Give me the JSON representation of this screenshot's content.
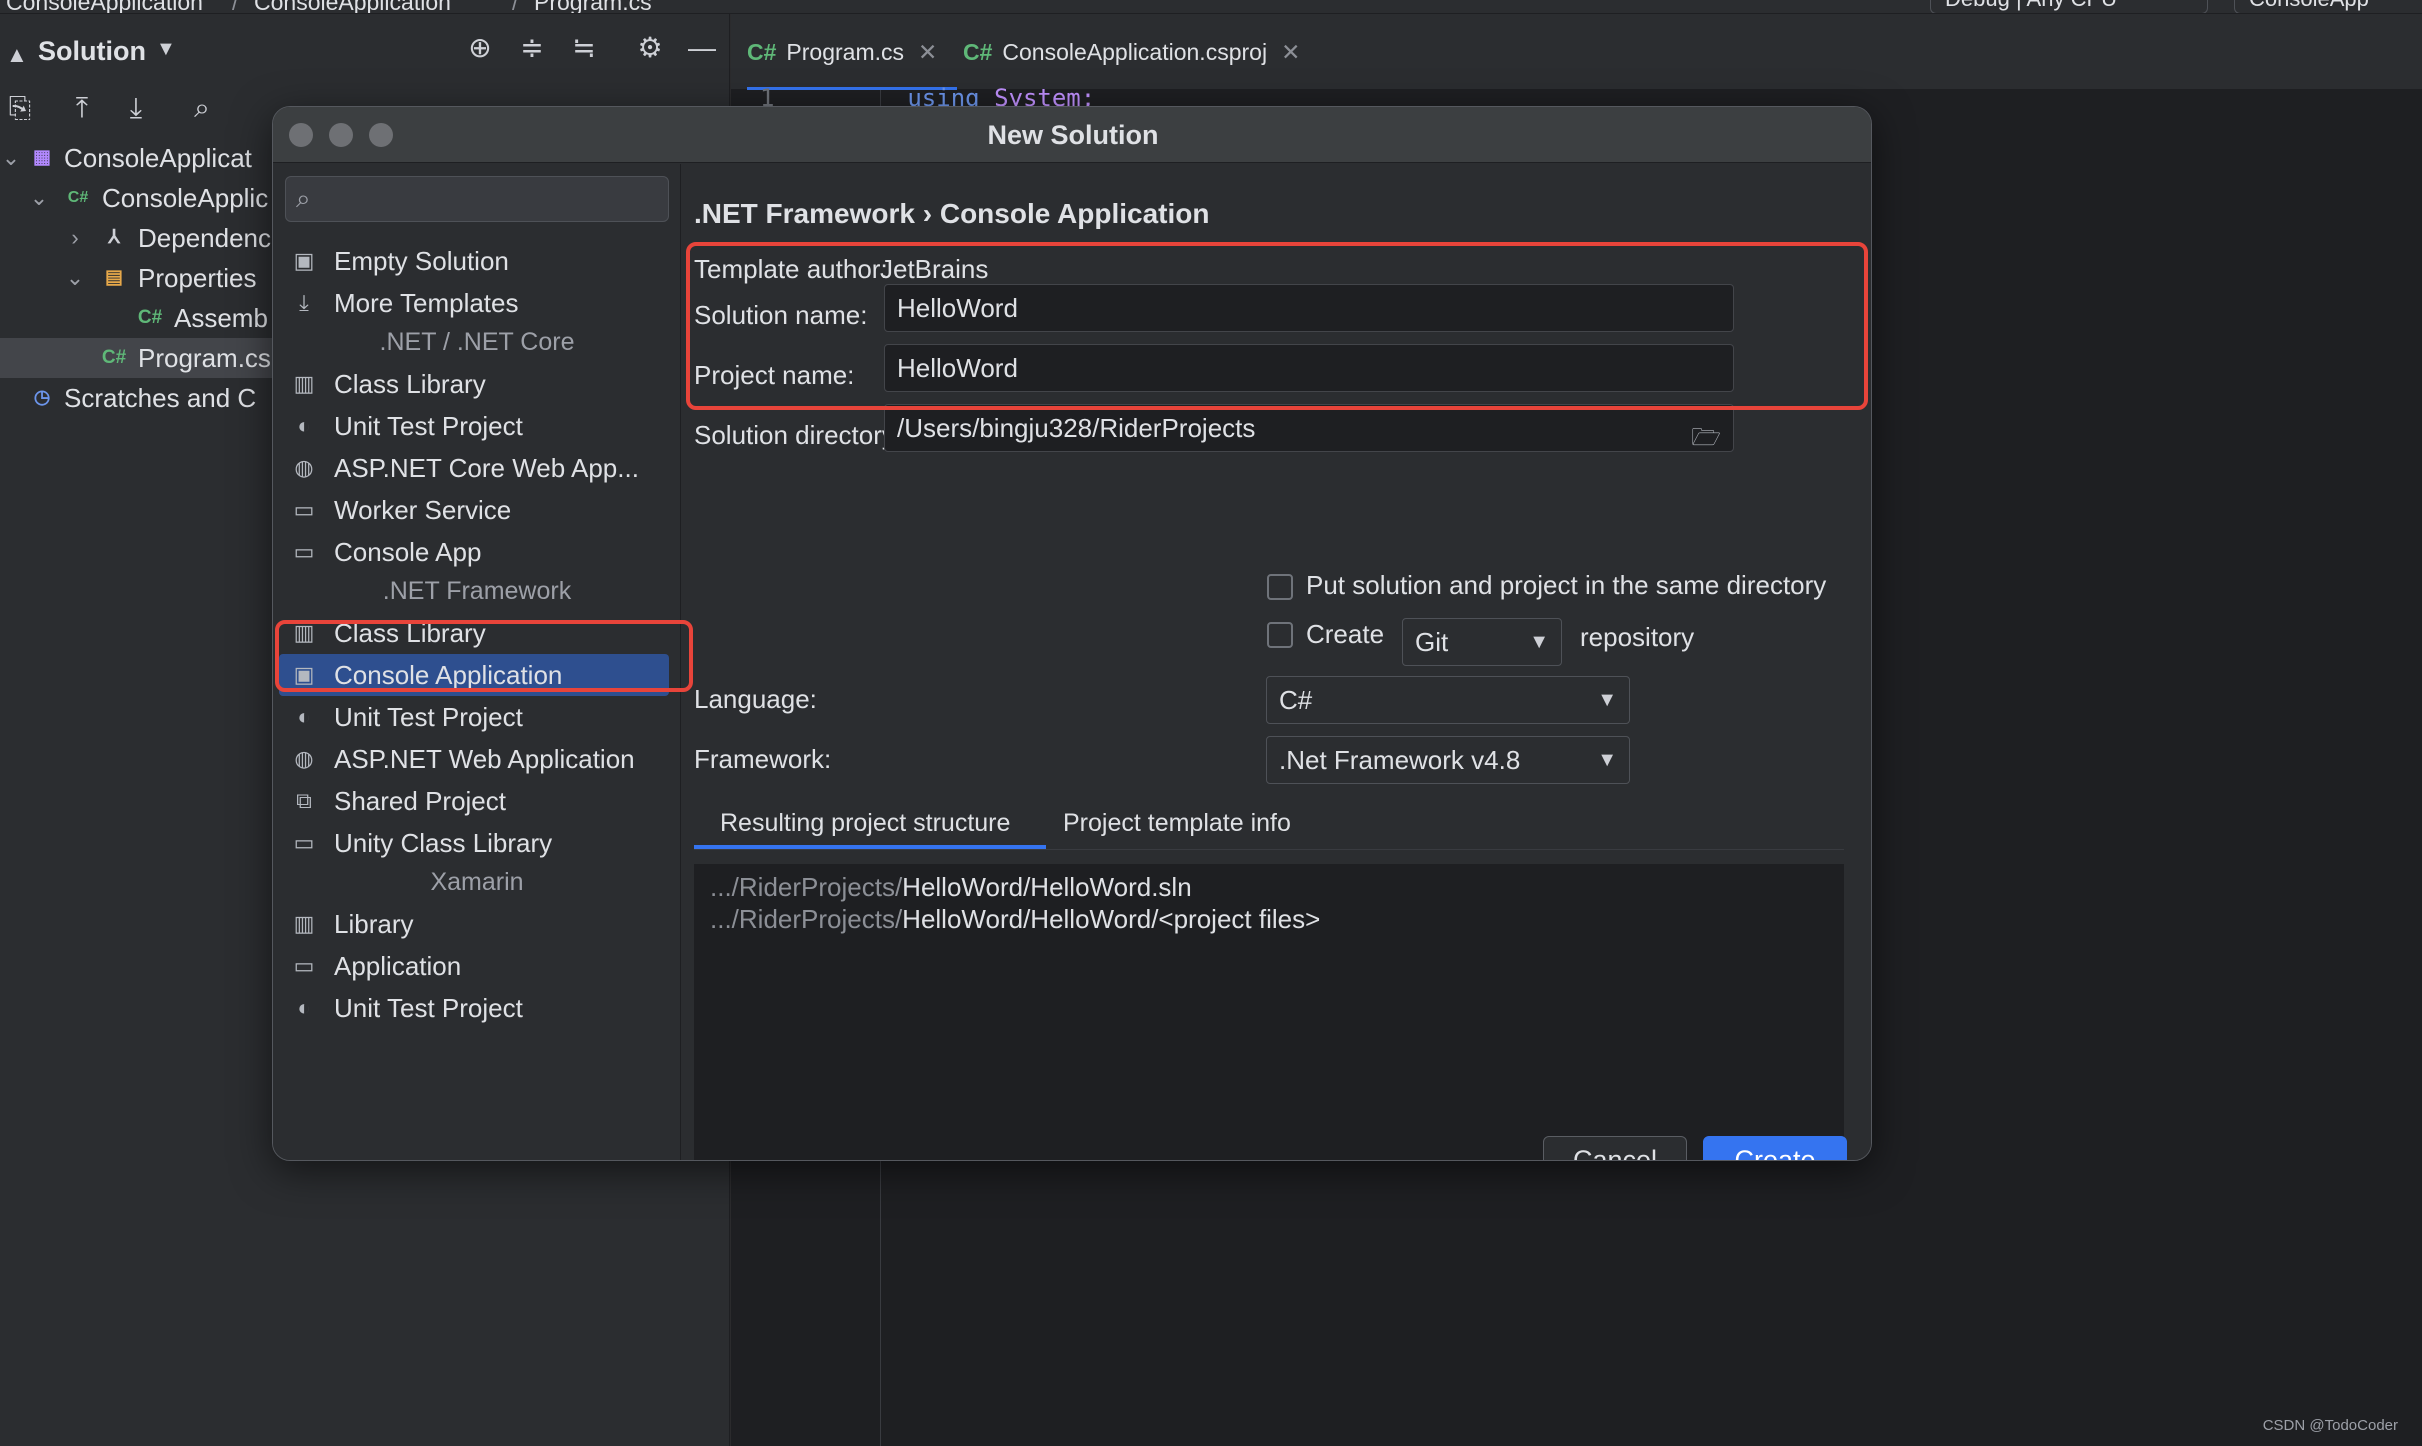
{
  "breadcrumb": {
    "project": "ConsoleApplication",
    "module": "ConsoleApplication",
    "file": "Program.cs",
    "run_config": "Debug | Any CPU",
    "run_target": "ConsoleApp"
  },
  "project_panel": {
    "title": "Solution",
    "tree": [
      {
        "label": "ConsoleApplicat",
        "icon": "solution-icon"
      },
      {
        "label": "ConsoleApplic",
        "icon": "csharp-project-icon"
      },
      {
        "label": "Dependenc",
        "icon": "dependencies-icon"
      },
      {
        "label": "Properties",
        "icon": "folder-icon"
      },
      {
        "label": "Assemb",
        "icon": "csharp-file-icon",
        "badge": "C#"
      },
      {
        "label": "Program.cs",
        "icon": "csharp-file-icon",
        "badge": "C#",
        "selected": true
      },
      {
        "label": "Scratches and C",
        "icon": "scratches-icon"
      }
    ]
  },
  "editor": {
    "tabs": [
      {
        "label": "Program.cs",
        "badge": "C#",
        "active": true
      },
      {
        "label": "ConsoleApplication.csproj",
        "badge": "C#",
        "active": false
      }
    ],
    "line_no": "1",
    "code_keyword": "using",
    "code_namespace": "System;"
  },
  "dialog": {
    "title": "New Solution",
    "search_placeholder": "",
    "templates": [
      {
        "type": "item",
        "label": "Empty Solution",
        "icon": "empty-solution-icon"
      },
      {
        "type": "item",
        "label": "More Templates",
        "icon": "download-icon"
      },
      {
        "type": "group",
        "label": ".NET / .NET Core"
      },
      {
        "type": "item",
        "label": "Class Library",
        "icon": "library-icon"
      },
      {
        "type": "item",
        "label": "Unit Test Project",
        "icon": "test-icon"
      },
      {
        "type": "item",
        "label": "ASP.NET Core Web App...",
        "icon": "globe-icon"
      },
      {
        "type": "item",
        "label": "Worker Service",
        "icon": "window-icon"
      },
      {
        "type": "item",
        "label": "Console App",
        "icon": "window-icon"
      },
      {
        "type": "group",
        "label": ".NET Framework"
      },
      {
        "type": "item",
        "label": "Class Library",
        "icon": "library-icon"
      },
      {
        "type": "item",
        "label": "Console Application",
        "icon": "console-icon",
        "selected": true
      },
      {
        "type": "item",
        "label": "Unit Test Project",
        "icon": "test-icon"
      },
      {
        "type": "item",
        "label": "ASP.NET Web Application",
        "icon": "globe-icon"
      },
      {
        "type": "item",
        "label": "Shared Project",
        "icon": "shared-icon"
      },
      {
        "type": "item",
        "label": "Unity Class Library",
        "icon": "window-icon"
      },
      {
        "type": "group",
        "label": "Xamarin"
      },
      {
        "type": "item",
        "label": "Library",
        "icon": "library-icon"
      },
      {
        "type": "item",
        "label": "Application",
        "icon": "window-icon"
      },
      {
        "type": "item",
        "label": "Unit Test Project",
        "icon": "test-icon"
      }
    ],
    "breadcrumb": {
      "parent": ".NET Framework",
      "separator": "›",
      "current": "Console Application"
    },
    "form": {
      "template_author_label": "Template author:",
      "template_author": "JetBrains",
      "solution_name_label": "Solution name:",
      "solution_name": "HelloWord",
      "project_name_label": "Project name:",
      "project_name": "HelloWord",
      "solution_dir_label": "Solution directory:",
      "solution_dir": "/Users/bingju328/RiderProjects",
      "same_dir_label": "Put solution and project in the same directory",
      "same_dir_checked": false,
      "create_label": "Create",
      "create_checked": false,
      "vcs": "Git",
      "repository_label": "repository",
      "language_label": "Language:",
      "language": "C#",
      "framework_label": "Framework:",
      "framework": ".Net Framework v4.8"
    },
    "info_tabs": [
      {
        "label": "Resulting project structure",
        "active": true
      },
      {
        "label": "Project template info",
        "active": false
      }
    ],
    "structure": [
      {
        "prefix": ".../RiderProjects/",
        "path": "HelloWord/HelloWord.sln"
      },
      {
        "prefix": ".../RiderProjects/",
        "path": "HelloWord/HelloWord/<project files>"
      }
    ],
    "buttons": {
      "cancel": "Cancel",
      "create": "Create"
    }
  },
  "watermark": "CSDN @TodoCoder",
  "colors": {
    "accent": "#3574f0",
    "selection": "#2e4f8f",
    "highlight": "#e8443a",
    "csharp_badge": "#5fb878"
  }
}
